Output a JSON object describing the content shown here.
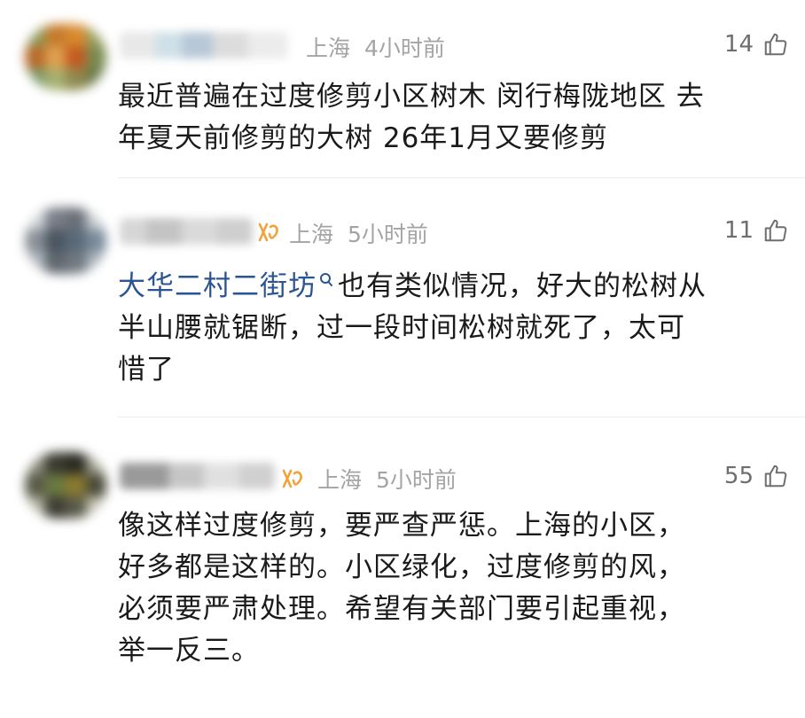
{
  "comments": [
    {
      "location": "上海",
      "time": "4小时前",
      "likes": "14",
      "has_badge": false,
      "lines": [
        "最近普遍在过度修剪小区树木 闵行梅陇地区 去",
        "年夏天前修剪的大树 26年1月又要修剪"
      ]
    },
    {
      "location": "上海",
      "time": "5小时前",
      "likes": "11",
      "has_badge": true,
      "topic": "大华二村二街坊",
      "topic_icon": "search-icon",
      "lines": [
        "也有类似情况，好大的松树从",
        "半山腰就锯断，过一段时间松树就死了，太可",
        "惜了"
      ]
    },
    {
      "location": "上海",
      "time": "5小时前",
      "likes": "55",
      "has_badge": true,
      "lines": [
        "像这样过度修剪，要严查严惩。上海的小区，",
        "好多都是这样的。小区绿化，过度修剪的风，",
        "必须要严肃处理。希望有关部门要引起重视，",
        "举一反三。"
      ]
    }
  ],
  "colors": {
    "topic_link": "#2b5591",
    "meta_text": "#a4a4a4",
    "badge": "#f2a23a"
  },
  "icons": {
    "like": "thumbs-up-icon",
    "badge": "member-badge-icon"
  }
}
